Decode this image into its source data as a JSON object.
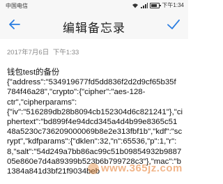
{
  "status_bar": {
    "carrier": "中国电信",
    "time": "下午1:34"
  },
  "toolbar": {
    "title": "编辑备忘录"
  },
  "note": {
    "date": "2017年7月6日",
    "time": "下午1:33",
    "hint": "",
    "lines": [
      "钱包test的备份",
      "{\"address\":\"534919677fd5dd836f2d2d9cf65b35f",
      "784f46a28\",\"crypto\":{\"cipher\":\"aes-128-",
      "ctr\",\"cipherparams\":",
      "{\"iv\":\"516289db28b8094cb152304d6c821241\"},\"ci",
      "phertext\":\"bd899f4e94dcd345a4d4b99e8365c51",
      "48a5230c736209000069b8e2e313fbf1b\",\"kdf\":\"sc",
      "rypt\",\"kdfparams\":{\"dklen\":32,\"n\":65536,\"p\":1,\"r\":",
      "8,\"salt\":\"54d249a7bb86ac99c51b09854932b9887",
      "05e860e7d4a89399b523b6b799728c3\"},\"mac\":\"b",
      "1384a841d3bf21f9034beb"
    ]
  },
  "watermark": {
    "text": "www.365jz.com"
  },
  "colors": {
    "accent": "#2a7de1",
    "toolbar_bg": "#f7f7f7"
  }
}
